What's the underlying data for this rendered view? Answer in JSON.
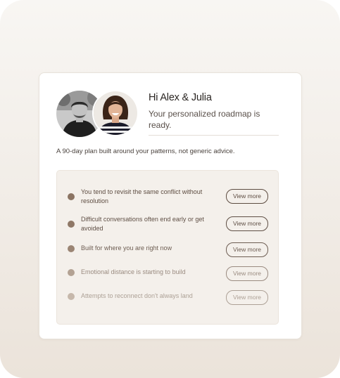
{
  "header": {
    "greeting": "Hi Alex & Julia",
    "message": "Your personalized roadmap is ready."
  },
  "subtitle": "A 90-day plan built around your patterns, not generic advice.",
  "avatars": [
    {
      "name": "Alex",
      "style": "black-and-white photo"
    },
    {
      "name": "Julia",
      "style": "color photo"
    }
  ],
  "items": [
    {
      "text": "You tend to revisit the same conflict without resolution",
      "button": "View more",
      "dot_color": "#8b7463",
      "text_color": "#5d4c41",
      "btn_color": "#5d4c41"
    },
    {
      "text": "Difficult conversations often end early or get avoided",
      "button": "View more",
      "dot_color": "#8f7867",
      "text_color": "#5f4f45",
      "btn_color": "#5f4f45"
    },
    {
      "text": "Built for where you are right now",
      "button": "View more",
      "dot_color": "#9b8574",
      "text_color": "#6d5d52",
      "btn_color": "#6d5d52"
    },
    {
      "text": "Emotional distance is starting to build",
      "button": "View more",
      "dot_color": "#b3a293",
      "text_color": "#9a8b80",
      "btn_color": "#9a8b80"
    },
    {
      "text": "Attempts to reconnect don't always land",
      "button": "View more",
      "dot_color": "#c6b8ab",
      "text_color": "#ada196",
      "btn_color": "#ada196"
    }
  ]
}
